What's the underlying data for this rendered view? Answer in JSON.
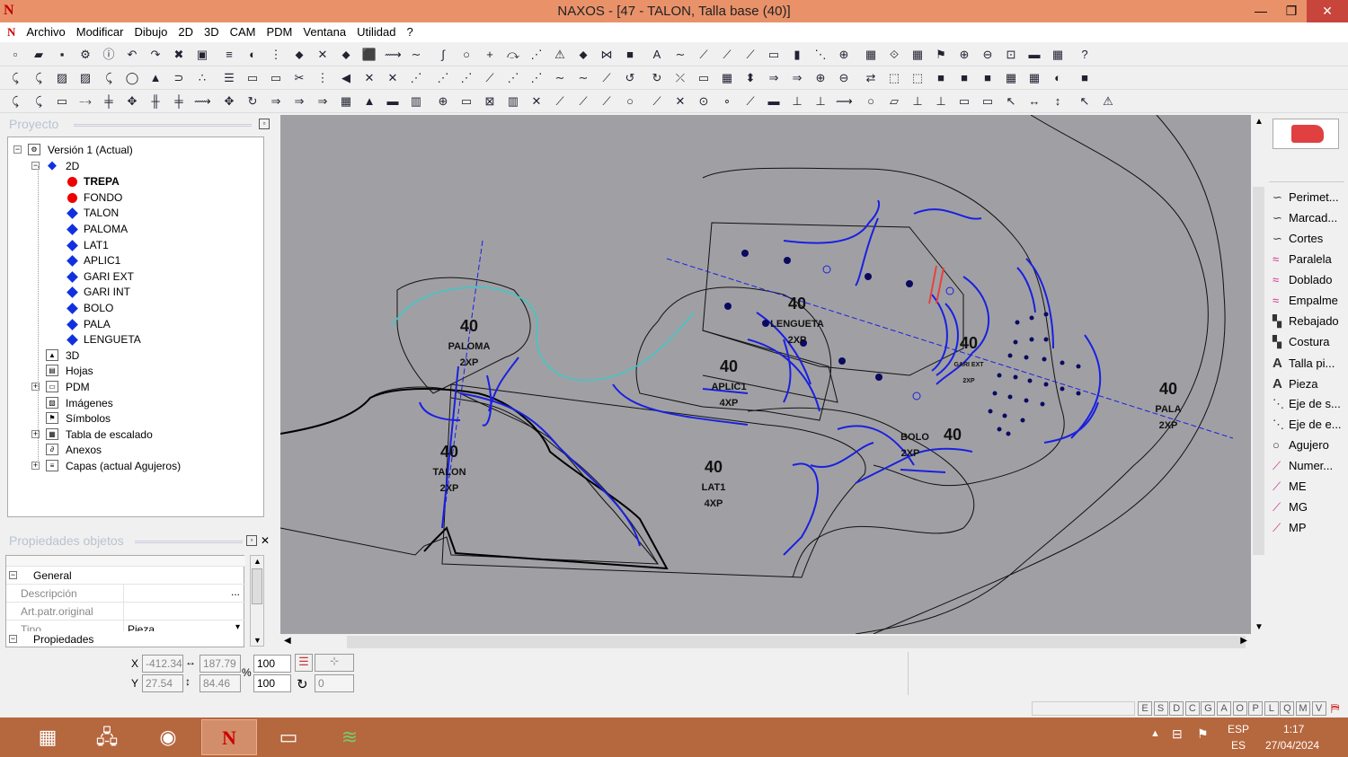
{
  "window": {
    "title": "NAXOS - [47 - TALON, Talla base (40)]",
    "logo": "N",
    "minimize": "—",
    "restore": "❐",
    "close": "✕"
  },
  "menu": [
    "Archivo",
    "Modificar",
    "Dibujo",
    "2D",
    "3D",
    "CAM",
    "PDM",
    "Ventana",
    "Utilidad",
    "?"
  ],
  "project": {
    "header": "Proyecto",
    "tree": [
      {
        "label": "Versión 1 (Actual)",
        "level": 0,
        "icon": "gear-icon",
        "expander": "−"
      },
      {
        "label": "2D",
        "level": 1,
        "icon": "cube-icon",
        "expander": "−"
      },
      {
        "label": "TREPA",
        "level": 2,
        "icon": "red-dot-icon",
        "bold": true
      },
      {
        "label": "FONDO",
        "level": 2,
        "icon": "red-dot-icon"
      },
      {
        "label": "TALON",
        "level": 2,
        "icon": "blue-diamond-icon"
      },
      {
        "label": "PALOMA",
        "level": 2,
        "icon": "blue-diamond-icon"
      },
      {
        "label": "LAT1",
        "level": 2,
        "icon": "blue-diamond-icon"
      },
      {
        "label": "APLIC1",
        "level": 2,
        "icon": "blue-diamond-icon"
      },
      {
        "label": "GARI EXT",
        "level": 2,
        "icon": "blue-diamond-icon"
      },
      {
        "label": "GARI INT",
        "level": 2,
        "icon": "blue-diamond-icon"
      },
      {
        "label": "BOLO",
        "level": 2,
        "icon": "blue-diamond-icon"
      },
      {
        "label": "PALA",
        "level": 2,
        "icon": "blue-diamond-icon"
      },
      {
        "label": "LENGUETA",
        "level": 2,
        "icon": "blue-diamond-icon"
      },
      {
        "label": "3D",
        "level": 1,
        "icon": "cube3d-icon"
      },
      {
        "label": "Hojas",
        "level": 1,
        "icon": "sheets-icon"
      },
      {
        "label": "PDM",
        "level": 1,
        "icon": "folder-icon",
        "expander": "+"
      },
      {
        "label": "Imágenes",
        "level": 1,
        "icon": "image-icon"
      },
      {
        "label": "Símbolos",
        "level": 1,
        "icon": "symbol-icon"
      },
      {
        "label": "Tabla de escalado",
        "level": 1,
        "icon": "table-icon",
        "expander": "+"
      },
      {
        "label": "Anexos",
        "level": 1,
        "icon": "paperclip-icon"
      },
      {
        "label": "Capas (actual Agujeros)",
        "level": 1,
        "icon": "layers-icon",
        "expander": "+"
      }
    ]
  },
  "properties": {
    "header": "Propiedades objetos",
    "section_general": "General",
    "section_props": "Propiedades",
    "rows": [
      {
        "label": "Descripción",
        "value": "",
        "button": "..."
      },
      {
        "label": "Art.patr.original",
        "value": ""
      },
      {
        "label": "Tipo",
        "value": "Pieza",
        "dropdown": "▾"
      }
    ]
  },
  "canvas": {
    "pieces": [
      {
        "size": "40",
        "name": "PALOMA",
        "mult": "2XP"
      },
      {
        "size": "40",
        "name": "TALON",
        "mult": "2XP"
      },
      {
        "size": "40",
        "name": "LAT1",
        "mult": "4XP"
      },
      {
        "size": "40",
        "name": "APLIC1",
        "mult": "4XP"
      },
      {
        "size": "40",
        "name": "LENGUETA",
        "mult": "2XP"
      },
      {
        "size": "40",
        "name": "BOLO",
        "mult": "2XP"
      },
      {
        "size": "40",
        "name": "GARI EXT",
        "mult": "2XP"
      },
      {
        "size": "40",
        "name": "PALA",
        "mult": "2XP"
      }
    ]
  },
  "right_panel": {
    "items": [
      {
        "label": "Perimet...",
        "icon": "curve-icon"
      },
      {
        "label": "Marcad...",
        "icon": "curve-icon"
      },
      {
        "label": "Cortes",
        "icon": "curve-icon"
      },
      {
        "label": "Paralela",
        "icon": "parallel-icon"
      },
      {
        "label": "Doblado",
        "icon": "fold-icon"
      },
      {
        "label": "Empalme",
        "icon": "join-icon"
      },
      {
        "label": "Rebajado",
        "icon": "skive-icon"
      },
      {
        "label": "Costura",
        "icon": "seam-icon"
      },
      {
        "label": "Talla pi...",
        "icon": "text-a-icon"
      },
      {
        "label": "Pieza",
        "icon": "text-a-icon"
      },
      {
        "label": "Eje de s...",
        "icon": "axis-icon"
      },
      {
        "label": "Eje de e...",
        "icon": "axis-icon"
      },
      {
        "label": "Agujero",
        "icon": "circle-icon"
      },
      {
        "label": "Numer...",
        "icon": "number-icon"
      },
      {
        "label": "ME",
        "icon": "mark-icon"
      },
      {
        "label": "MG",
        "icon": "mark-icon"
      },
      {
        "label": "MP",
        "icon": "mark-icon"
      }
    ]
  },
  "coords": {
    "x_label": "X",
    "y_label": "Y",
    "x": "-412.34",
    "y": "27.54",
    "width": "187.79",
    "height": "84.46",
    "scale_x": "100",
    "scale_y": "100",
    "percent": "%",
    "rotation": "0"
  },
  "status_keys": [
    "E",
    "S",
    "D",
    "C",
    "G",
    "A",
    "O",
    "P",
    "L",
    "Q",
    "M",
    "V"
  ],
  "tray": {
    "lang1": "ESP",
    "lang2": "ES",
    "time": "1:17",
    "date": "27/04/2024"
  },
  "colors": {
    "titlebar": "#e9926a",
    "canvas_bg": "#a0a0a4",
    "taskbar": "#b5673e",
    "outline_blue": "#1a20e0"
  }
}
